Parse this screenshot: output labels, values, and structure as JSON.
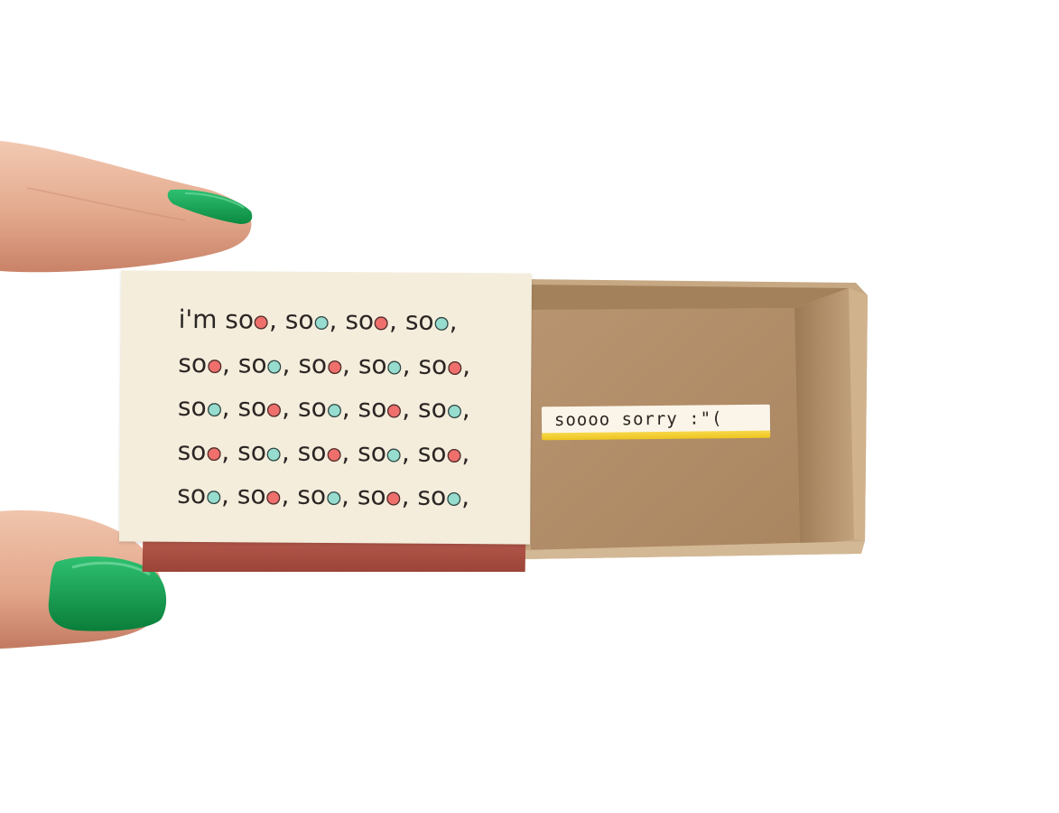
{
  "card": {
    "lines": [
      [
        {
          "t": "i'm so"
        },
        {
          "d": "r"
        },
        {
          "t": ", so"
        },
        {
          "d": "t"
        },
        {
          "t": ", so"
        },
        {
          "d": "r"
        },
        {
          "t": ", so"
        },
        {
          "d": "t"
        },
        {
          "t": ","
        }
      ],
      [
        {
          "t": "so"
        },
        {
          "d": "r"
        },
        {
          "t": ", so"
        },
        {
          "d": "t"
        },
        {
          "t": ", so"
        },
        {
          "d": "r"
        },
        {
          "t": ", so"
        },
        {
          "d": "t"
        },
        {
          "t": ", so"
        },
        {
          "d": "r"
        },
        {
          "t": ","
        }
      ],
      [
        {
          "t": "so"
        },
        {
          "d": "t"
        },
        {
          "t": ", so"
        },
        {
          "d": "r"
        },
        {
          "t": ", so"
        },
        {
          "d": "t"
        },
        {
          "t": ", so"
        },
        {
          "d": "r"
        },
        {
          "t": ", so"
        },
        {
          "d": "t"
        },
        {
          "t": ","
        }
      ],
      [
        {
          "t": "so"
        },
        {
          "d": "r"
        },
        {
          "t": ", so"
        },
        {
          "d": "t"
        },
        {
          "t": ", so"
        },
        {
          "d": "r"
        },
        {
          "t": ", so"
        },
        {
          "d": "t"
        },
        {
          "t": ", so"
        },
        {
          "d": "r"
        },
        {
          "t": ","
        }
      ],
      [
        {
          "t": "so"
        },
        {
          "d": "t"
        },
        {
          "t": ", so"
        },
        {
          "d": "r"
        },
        {
          "t": ", so"
        },
        {
          "d": "t"
        },
        {
          "t": ", so"
        },
        {
          "d": "r"
        },
        {
          "t": ", so"
        },
        {
          "d": "t"
        },
        {
          "t": ","
        }
      ]
    ]
  },
  "strip": {
    "text": "soooo sorry :\"("
  },
  "colors": {
    "card": "#f4eddc",
    "dot_red": "#ee6f6c",
    "dot_teal": "#96dccf",
    "sleeve_red": "#a84a3e",
    "kraft": "#b08c64",
    "nail_green": "#12a04e",
    "skin": "#e9b79e",
    "strip_edge": "#f2cc2c"
  }
}
